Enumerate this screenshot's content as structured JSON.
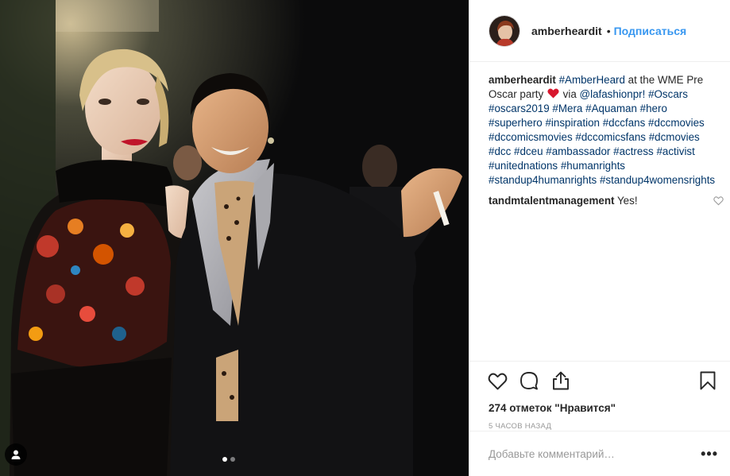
{
  "media": {
    "slide_count": 2,
    "active_slide": 1,
    "tag_icon": "user-tag-icon"
  },
  "header": {
    "username": "amberheardit",
    "separator": "•",
    "follow_label": "Подписаться",
    "avatar_icon": "profile-avatar"
  },
  "caption": {
    "username": "amberheardit",
    "parts": {
      "p1": "#AmberHeard",
      "p2": " at the WME Pre Oscar party ",
      "p3": " via ",
      "p4": "@lafashionpr!",
      "p5": " ",
      "p6": "#Oscars",
      "p7": "#oscars2019",
      "p8": "#Mera",
      "p9": "#Aquaman",
      "p10": "#hero",
      "p11": "#superhero",
      "p12": "#inspiration",
      "p13": "#dccfans",
      "p14": "#dccmovies",
      "p15": "#dccomicsmovies",
      "p16": "#dccomicsfans",
      "p17": "#dcmovies",
      "p18": "#dcc",
      "p19": "#dceu",
      "p20": "#ambassador",
      "p21": "#actress",
      "p22": "#activist",
      "p23": "#unitednations",
      "p24": "#humanrights",
      "p25": "#standup4humanrights",
      "p26": "#standup4womensrights"
    },
    "emoji": "red-heart"
  },
  "comments": [
    {
      "username": "tandmtalentmanagement",
      "text": "Yes!"
    }
  ],
  "actions": {
    "like_icon": "heart-outline-icon",
    "comment_icon": "comment-bubble-icon",
    "share_icon": "share-upload-icon",
    "save_icon": "bookmark-icon"
  },
  "likes_text": "274 отметок \"Нравится\"",
  "timestamp": "5 часов назад",
  "add_comment": {
    "placeholder": "Добавьте комментарий…",
    "more_label": "•••"
  },
  "colors": {
    "link_blue": "#3897f0",
    "hashtag": "#003569",
    "muted": "#999999",
    "heart_red": "#e0245e"
  }
}
